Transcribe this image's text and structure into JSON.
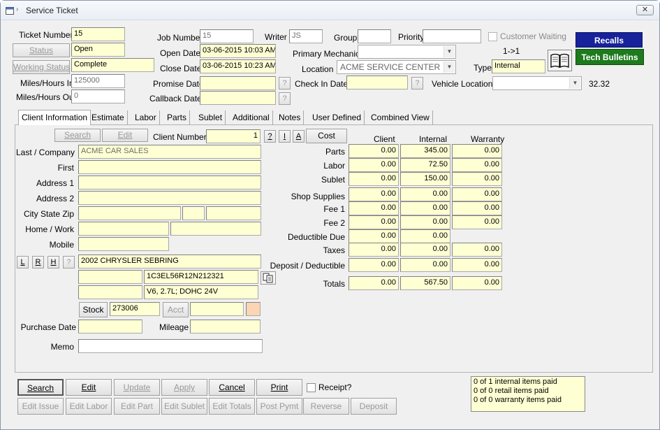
{
  "window": {
    "title": "Service Ticket",
    "close": "✕"
  },
  "header": {
    "ticket_number_label": "Ticket Number",
    "ticket_number": "15",
    "status_button": "Status",
    "status": "Open",
    "working_status_button": "Working Status",
    "working_status": "Complete",
    "miles_in_label": "Miles/Hours In",
    "miles_in": "125000",
    "miles_out_label": "Miles/Hours Out",
    "miles_out": "0",
    "job_number_label": "Job Number",
    "job_number": "15",
    "writer_label": "Writer",
    "writer": "JS",
    "group_label": "Group",
    "group": "",
    "priority_label": "Priority",
    "priority": "",
    "customer_waiting_label": "Customer Waiting",
    "open_date_label": "Open Date",
    "open_date": "03-06-2015 10:03 AM",
    "close_date_label": "Close Date",
    "close_date": "03-06-2015 10:23 AM",
    "promise_date_label": "Promise Date",
    "promise_date": "",
    "callback_date_label": "Callback Date",
    "callback_date": "",
    "primary_mechanic_label": "Primary Mechanic",
    "primary_mechanic": "",
    "location_label": "Location",
    "location": "ACME SERVICE CENTER",
    "check_in_date_label": "Check In Date",
    "check_in_date": "",
    "vehicle_location_label": "Vehicle Location",
    "vehicle_location": "",
    "vehicle_location_value": "32.32",
    "type_label": "Type",
    "type": "Internal",
    "counter": "1->1",
    "recalls": "Recalls",
    "tech_bulletins": "Tech Bulletins",
    "help_q": "?"
  },
  "tabs": [
    {
      "label": "Client Information",
      "active": true
    },
    {
      "label": "Estimate"
    },
    {
      "label": "Labor"
    },
    {
      "label": "Parts"
    },
    {
      "label": "Sublet"
    },
    {
      "label": "Additional"
    },
    {
      "label": "Notes"
    },
    {
      "label": "User Defined"
    },
    {
      "label": "Combined View"
    }
  ],
  "client": {
    "search_button": "Search",
    "edit_button": "Edit",
    "client_number_label": "Client Number",
    "client_number": "1",
    "btn_q": "?",
    "btn_i": "I",
    "btn_a": "A",
    "last_company_label": "Last / Company",
    "last_company": "ACME CAR SALES",
    "first_label": "First",
    "first": "",
    "address1_label": "Address 1",
    "address1": "",
    "address2_label": "Address 2",
    "address2": "",
    "city_state_zip_label": "City State Zip",
    "home_work_label": "Home / Work",
    "mobile_label": "Mobile",
    "btn_l": "L",
    "btn_r": "R",
    "btn_h": "H",
    "btn_q2": "?",
    "vehicle": "2002 CHRYSLER SEBRING",
    "vin": "1C3EL56R12N212321",
    "engine": "V6, 2.7L; DOHC 24V",
    "stock_button": "Stock",
    "stock": "273006",
    "acct_button": "Acct",
    "purchase_date_label": "Purchase Date",
    "purchase_date": "",
    "mileage_label": "Mileage",
    "mileage": "",
    "memo_label": "Memo",
    "memo": ""
  },
  "costs": {
    "cost_button": "Cost",
    "col_client": "Client",
    "col_internal": "Internal",
    "col_warranty": "Warranty",
    "rows": [
      {
        "label": "Parts",
        "client": "0.00",
        "internal": "345.00",
        "warranty": "0.00"
      },
      {
        "label": "Labor",
        "client": "0.00",
        "internal": "72.50",
        "warranty": "0.00"
      },
      {
        "label": "Sublet",
        "client": "0.00",
        "internal": "150.00",
        "warranty": "0.00"
      },
      {
        "label": "Shop Supplies",
        "client": "0.00",
        "internal": "0.00",
        "warranty": "0.00"
      },
      {
        "label": "Fee 1",
        "client": "0.00",
        "internal": "0.00",
        "warranty": "0.00"
      },
      {
        "label": "Fee 2",
        "client": "0.00",
        "internal": "0.00",
        "warranty": "0.00"
      },
      {
        "label": "Deductible Due",
        "client": "0.00",
        "internal": "0.00"
      },
      {
        "label": "Taxes",
        "client": "0.00",
        "internal": "0.00",
        "warranty": "0.00"
      },
      {
        "label": "Deposit / Deductible",
        "client": "0.00",
        "internal": "0.00",
        "warranty": "0.00"
      },
      {
        "label": "Totals",
        "client": "0.00",
        "internal": "567.50",
        "warranty": "0.00"
      }
    ]
  },
  "footer": {
    "search": "Search",
    "edit": "Edit",
    "update": "Update",
    "apply": "Apply",
    "cancel": "Cancel",
    "print": "Print",
    "receipt_label": "Receipt?",
    "edit_issue": "Edit Issue",
    "edit_labor": "Edit Labor",
    "edit_part": "Edit Part",
    "edit_sublet": "Edit Sublet",
    "edit_totals": "Edit Totals",
    "post_pymt": "Post Pymt",
    "reverse": "Reverse",
    "deposit": "Deposit",
    "paid_lines": [
      "0 of 1 internal items paid",
      "0 of 0 retail items paid",
      "0 of 0 warranty items paid"
    ]
  }
}
